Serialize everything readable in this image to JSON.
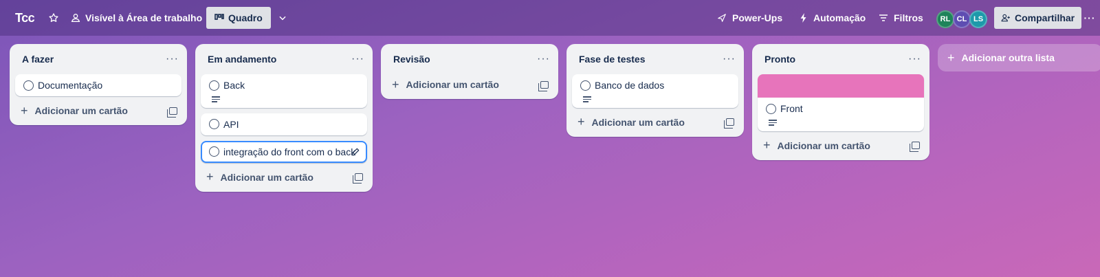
{
  "topbar": {
    "board_title": "Tcc",
    "visibility": "Visível à Área de trabalho",
    "view": "Quadro",
    "powerups": "Power-Ups",
    "automation": "Automação",
    "filters": "Filtros",
    "share": "Compartilhar",
    "avatars": [
      {
        "initials": "RL",
        "color": "#1f845a"
      },
      {
        "initials": "CL",
        "color": "#5e4db2"
      },
      {
        "initials": "LS",
        "color": "#1d9aaa"
      }
    ]
  },
  "lists": [
    {
      "title": "A fazer",
      "cards": [
        {
          "title": "Documentação"
        }
      ],
      "add": "Adicionar um cartão"
    },
    {
      "title": "Em andamento",
      "cards": [
        {
          "title": "Back"
        },
        {
          "title": "API"
        },
        {
          "title": "integração do front com o back"
        }
      ],
      "add": "Adicionar um cartão"
    },
    {
      "title": "Revisão",
      "cards": [],
      "add": "Adicionar um cartão"
    },
    {
      "title": "Fase de testes",
      "cards": [
        {
          "title": "Banco de dados"
        }
      ],
      "add": "Adicionar um cartão"
    },
    {
      "title": "Pronto",
      "cards": [
        {
          "title": "Front",
          "cover_color": "#e774bb"
        }
      ],
      "add": "Adicionar um cartão"
    }
  ],
  "add_list": "Adicionar outra lista"
}
